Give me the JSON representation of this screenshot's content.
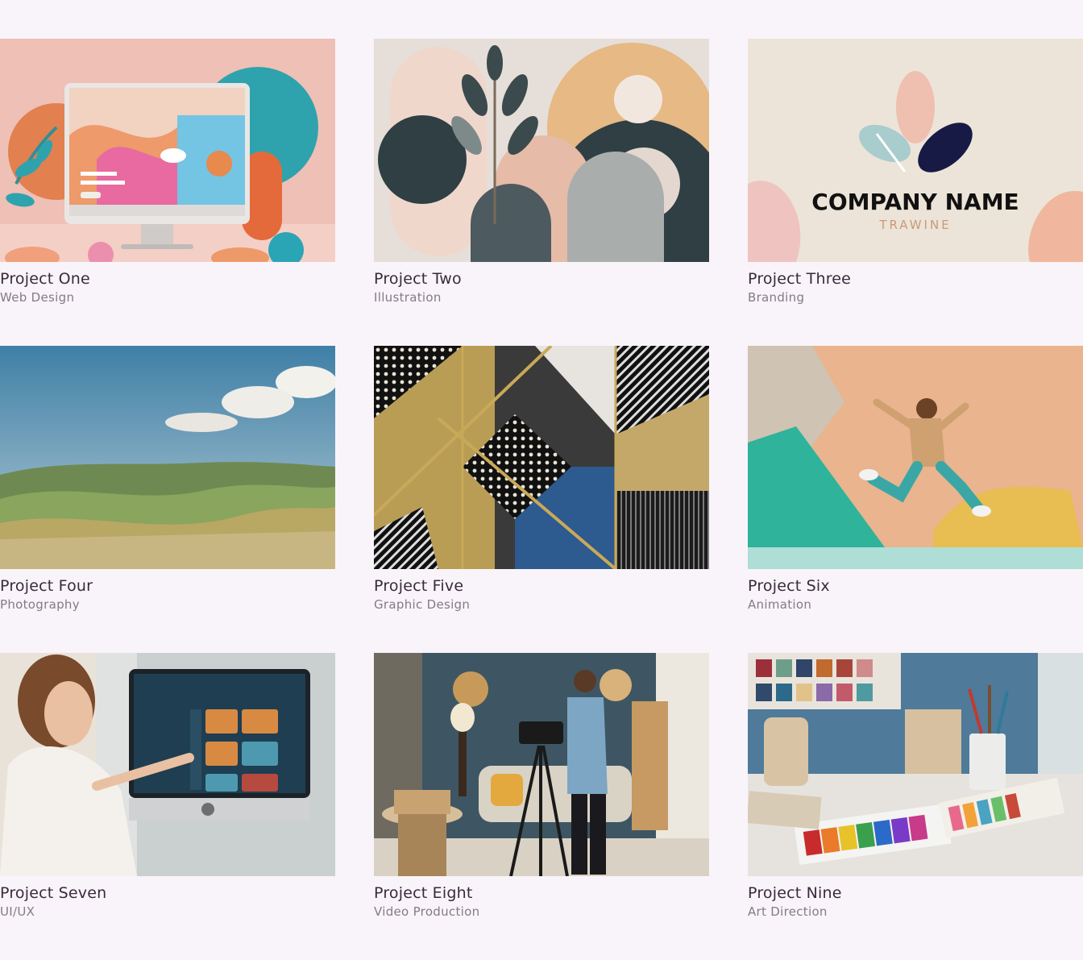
{
  "projects": [
    {
      "title": "Project One",
      "category": "Web Design",
      "image": "paper-craft-desktop-monitor-website"
    },
    {
      "title": "Project Two",
      "category": "Illustration",
      "image": "paper-cut-botanical-shapes"
    },
    {
      "title": "Project Three",
      "category": "Branding",
      "image": "leaf-logo-company-name",
      "logo": {
        "name": "COMPANY NAME",
        "tagline": "TRAWINE"
      }
    },
    {
      "title": "Project Four",
      "category": "Photography",
      "image": "rolling-hills-landscape"
    },
    {
      "title": "Project Five",
      "category": "Graphic Design",
      "image": "geometric-gold-pattern"
    },
    {
      "title": "Project Six",
      "category": "Animation",
      "image": "paper-character-jumping"
    },
    {
      "title": "Project Seven",
      "category": "UI/UX",
      "image": "woman-touching-dashboard-screen"
    },
    {
      "title": "Project Eight",
      "category": "Video Production",
      "image": "videographer-with-camera-in-studio"
    },
    {
      "title": "Project Nine",
      "category": "Art Direction",
      "image": "color-swatches-and-brushes"
    }
  ]
}
